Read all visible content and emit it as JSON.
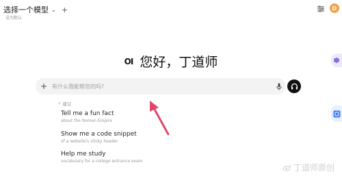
{
  "header": {
    "model_select_label": "选择一个模型",
    "set_default_label": "设为默认",
    "avatar_letter": "D"
  },
  "greeting": {
    "logo_text": "OI",
    "text": "您好，丁道师"
  },
  "chat_input": {
    "placeholder": "有什么我能帮您的吗?"
  },
  "suggestions": {
    "header": "建议",
    "items": [
      {
        "title": "Tell me a fun fact",
        "subtitle": "about the Roman Empire"
      },
      {
        "title": "Show me a code snippet",
        "subtitle": "of a website's sticky header"
      },
      {
        "title": "Help me study",
        "subtitle": "vocabulary for a college entrance exam"
      }
    ]
  },
  "watermark": "丁道师原创",
  "colors": {
    "annotation_arrow": "#e0476b",
    "avatar": "#f2a24b",
    "voice_button": "#111111"
  }
}
